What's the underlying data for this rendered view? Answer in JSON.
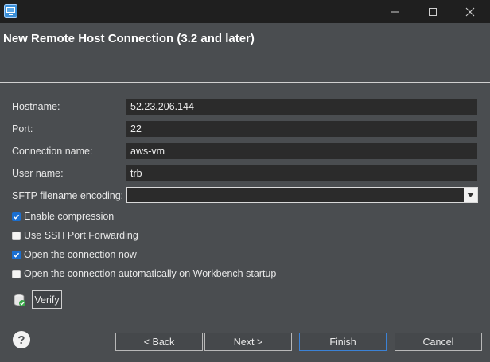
{
  "window": {
    "app_icon": "eclipse-remote-systems-icon",
    "controls": [
      "minimize-icon",
      "maximize-icon",
      "close-icon"
    ]
  },
  "dialog": {
    "title": "New Remote Host Connection (3.2 and later)"
  },
  "form": {
    "hostname": {
      "label": "Hostname:",
      "value": "52.23.206.144"
    },
    "port": {
      "label": "Port:",
      "value": "22"
    },
    "connection_name": {
      "label": "Connection name:",
      "value": "aws-vm"
    },
    "user_name": {
      "label": "User name:",
      "value": "trb"
    },
    "sftp_encoding": {
      "label": "SFTP filename encoding:",
      "value": ""
    }
  },
  "options": [
    {
      "label": "Enable compression",
      "checked": true
    },
    {
      "label": "Use SSH Port Forwarding",
      "checked": false
    },
    {
      "label": "Open the connection now",
      "checked": true
    },
    {
      "label": "Open the connection automatically on Workbench startup",
      "checked": false
    }
  ],
  "verify": {
    "label": "Verify",
    "icon": "verify-connection-icon"
  },
  "footer": {
    "help_icon": "help-icon",
    "back": "< Back",
    "next": "Next >",
    "finish": "Finish",
    "cancel": "Cancel"
  },
  "colors": {
    "background": "#4a4d50",
    "titlebar": "#1f1f1f",
    "field": "#2b2b2b",
    "checkbox_checked": "#1a6fd1",
    "default_button_border": "#3b82d6"
  }
}
